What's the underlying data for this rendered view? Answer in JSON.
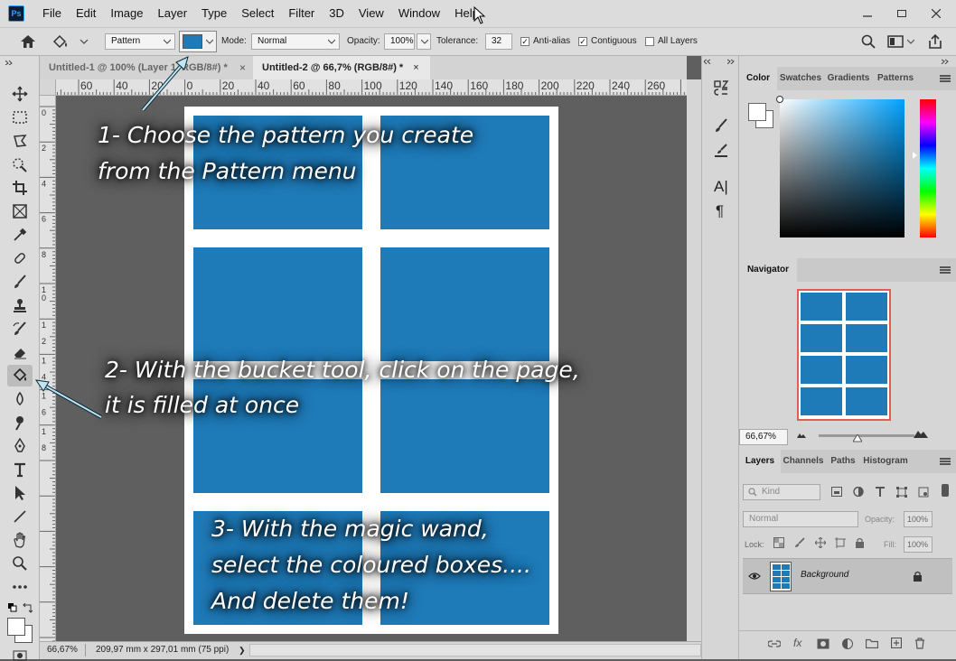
{
  "app": {
    "logo": "Ps"
  },
  "menu": [
    "File",
    "Edit",
    "Image",
    "Layer",
    "Type",
    "Select",
    "Filter",
    "3D",
    "View",
    "Window",
    "Help"
  ],
  "options": {
    "fill_source": "Pattern",
    "mode_label": "Mode:",
    "mode_value": "Normal",
    "opacity_label": "Opacity:",
    "opacity_value": "100%",
    "tolerance_label": "Tolerance:",
    "tolerance_value": "32",
    "antialias_label": "Anti-alias",
    "contiguous_label": "Contiguous",
    "all_layers_label": "All Layers",
    "foreground_color": "#1f7ab8"
  },
  "tabs": [
    {
      "label": "Untitled-1 @ 100% (Layer 1, RGB/8#) *",
      "close": "×"
    },
    {
      "label": "Untitled-2 @ 66,7% (RGB/8#) *",
      "close": "×"
    }
  ],
  "ruler_h": [
    "60",
    "40",
    "20",
    "0",
    "20",
    "40",
    "60",
    "80",
    "100",
    "120",
    "140",
    "160",
    "180",
    "200",
    "220",
    "240",
    "260"
  ],
  "ruler_v": [
    "0",
    "2",
    "4",
    "6",
    "8",
    "10",
    "1 2",
    "1 4",
    "1 6",
    "1 8"
  ],
  "status": {
    "zoom": "66,67%",
    "doc_info": "209,97 mm x 297,01 mm (75 ppi)",
    "arrow": "❯"
  },
  "panels": {
    "color_tabs": [
      "Color",
      "Swatches",
      "Gradients",
      "Patterns"
    ],
    "navigator_title": "Navigator",
    "navigator_zoom": "66,67%",
    "layers_tabs": [
      "Layers",
      "Channels",
      "Paths",
      "Histogram"
    ],
    "kind_placeholder": "Kind",
    "blend_mode": "Normal",
    "opacity_label": "Opacity:",
    "opacity_value": "100%",
    "lock_label": "Lock:",
    "fill_label": "Fill:",
    "fill_value": "100%",
    "layer_name": "Background",
    "footer_fx": "fx"
  },
  "doc": {
    "box_color": "#1f7ab8",
    "page_color": "#ffffff"
  },
  "annotations": {
    "step1_line1": "1- Choose the pattern you create",
    "step1_line2": "from the Pattern menu",
    "step2_line1": "2- With the bucket tool, click on the page,",
    "step2_line2": "it is filled at once",
    "step3_line1": "3- With the magic wand,",
    "step3_line2": "select the coloured boxes....",
    "step3_line3": "And delete them!"
  },
  "dock_labels": {
    "paragraph_text": "A|",
    "pilcrow": "¶"
  }
}
